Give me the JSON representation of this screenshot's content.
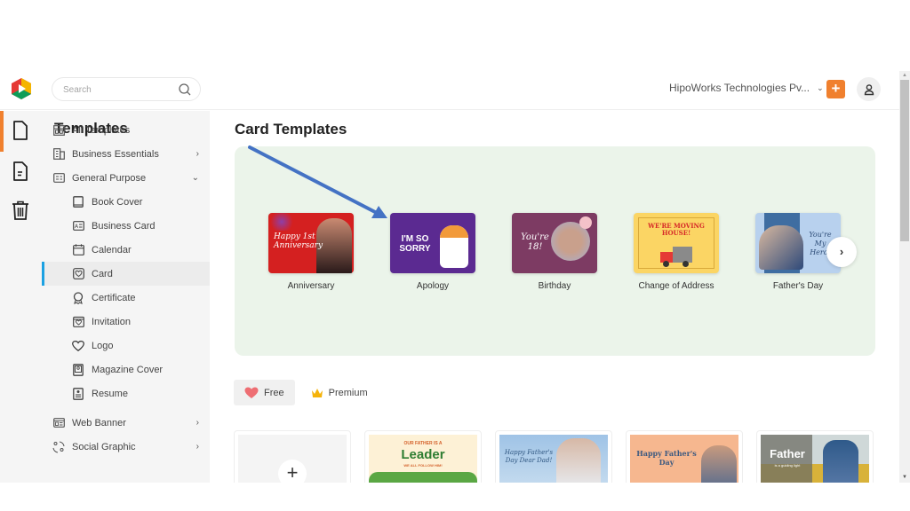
{
  "search": {
    "placeholder": "Search"
  },
  "header": {
    "organization": "HipoWorks Technologies Pv...",
    "add_label": "+"
  },
  "colors": {
    "accent": "#f0802e",
    "active_indicator": "#1ba1e2",
    "hero_bg": "#ebf4ea",
    "arrow": "#4472c4"
  },
  "rail": {
    "items": [
      {
        "icon": "file-icon",
        "active": true
      },
      {
        "icon": "document-icon",
        "active": false
      },
      {
        "icon": "trash-icon",
        "active": false
      }
    ]
  },
  "sidebar": {
    "title": "Templates",
    "items": [
      {
        "label": "All Templates",
        "icon": "grid-icon",
        "level": "top"
      },
      {
        "label": "Business Essentials",
        "icon": "building-icon",
        "level": "top",
        "arrow": "›"
      },
      {
        "label": "General Purpose",
        "icon": "list-icon",
        "level": "top",
        "arrow": "⌄"
      },
      {
        "label": "Book Cover",
        "icon": "book-icon",
        "level": "sub"
      },
      {
        "label": "Business Card",
        "icon": "id-card-icon",
        "level": "sub"
      },
      {
        "label": "Calendar",
        "icon": "calendar-icon",
        "level": "sub"
      },
      {
        "label": "Card",
        "icon": "card-icon",
        "level": "sub",
        "active": true
      },
      {
        "label": "Certificate",
        "icon": "award-icon",
        "level": "sub"
      },
      {
        "label": "Invitation",
        "icon": "invitation-icon",
        "level": "sub"
      },
      {
        "label": "Logo",
        "icon": "heart-icon",
        "level": "sub"
      },
      {
        "label": "Magazine Cover",
        "icon": "magazine-icon",
        "level": "sub"
      },
      {
        "label": "Resume",
        "icon": "resume-icon",
        "level": "sub"
      },
      {
        "label": "Web Banner",
        "icon": "banner-icon",
        "level": "top",
        "arrow": "›"
      },
      {
        "label": "Social Graphic",
        "icon": "social-icon",
        "level": "top",
        "arrow": "›"
      }
    ]
  },
  "main": {
    "title": "Card Templates",
    "categories": [
      {
        "label": "Anniversary",
        "thumb_text": "Happy 1st Anniversary"
      },
      {
        "label": "Apology",
        "thumb_text": "I'M SO SORRY"
      },
      {
        "label": "Birthday",
        "thumb_text": "You're 18!"
      },
      {
        "label": "Change of Address",
        "thumb_text": "WE'RE MOVING HOUSE!"
      },
      {
        "label": "Father's Day",
        "thumb_text": "You're My Hero!"
      }
    ],
    "next_label": "›",
    "filters": [
      {
        "label": "Free",
        "active": true
      },
      {
        "label": "Premium",
        "active": false
      }
    ],
    "templates": [
      {
        "type": "blank",
        "label": "+"
      },
      {
        "thumb_top": "OUR FATHER IS A",
        "thumb_title": "Leader",
        "thumb_sub": "WE ALL FOLLOW HIM!"
      },
      {
        "thumb_title": "Happy Father's Day Dear Dad!"
      },
      {
        "thumb_title": "Happy Father's Day"
      },
      {
        "thumb_title": "Father",
        "thumb_sub": "is a guiding light"
      }
    ]
  }
}
